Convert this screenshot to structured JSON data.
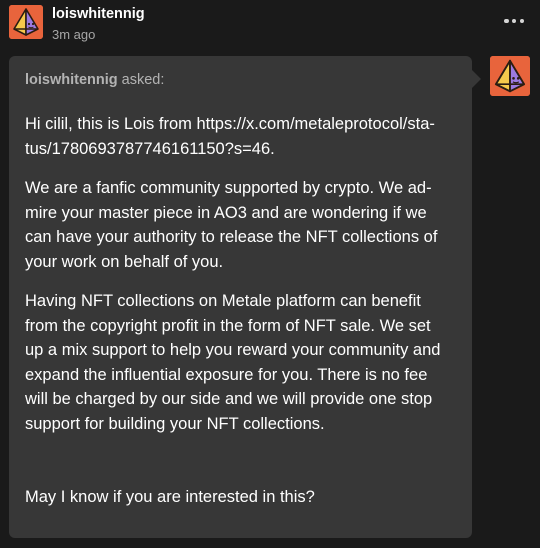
{
  "post": {
    "author": "loiswhitennig",
    "timestamp": "3m ago",
    "menu_icon": "more-options-icon"
  },
  "ask": {
    "asker": "loiswhitennig",
    "asked_label": "asked:",
    "paragraphs": [
      [
        "Hi cilil, this is Lois from https://x.com/metaleprotocol/sta-",
        "tus/1780693787746161150?s=46."
      ],
      [
        "We are a fanfic community supported by crypto. We ad-",
        "mire your master piece in AO3 and are wondering if we",
        "can have your authority to release the NFT collections of",
        "your work on behalf of you."
      ],
      [
        "Having NFT collections on Metale platform can benefit",
        "from the copyright profit in the form of NFT sale. We set",
        "up a mix support to help you reward your community and",
        "expand the influential exposure for you. There is no fee",
        "will be charged by our side and we will provide one stop",
        "support for building your NFT collections."
      ],
      [
        "May I know if you are interested in this?"
      ]
    ]
  },
  "colors": {
    "background": "#1a1a1a",
    "bubble": "#373737",
    "avatar_bg": "#e8643c",
    "muted_text": "#a6a6a6"
  }
}
